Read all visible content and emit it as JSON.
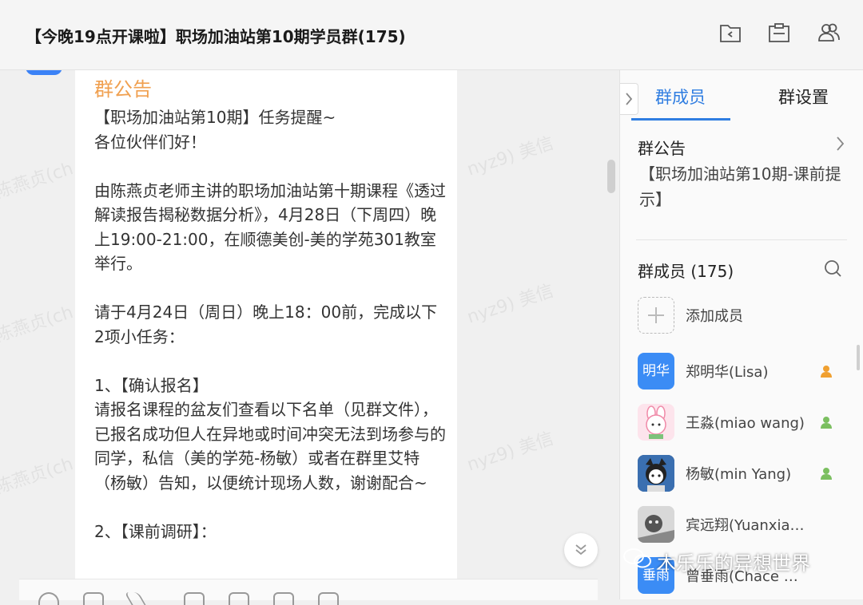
{
  "header": {
    "title": "【今晚19点开课啦】职场加油站第10期学员群(175)",
    "icons": [
      "folder-share-icon",
      "announcement-icon",
      "members-icon"
    ]
  },
  "chat": {
    "announcement_title": "群公告",
    "announcement_body": "【职场加油站第10期】任务提醒~\n各位伙伴们好！\n\n由陈燕贞老师主讲的职场加油站第十期课程《透过解读报告揭秘数据分析》，4月28日（下周四）晚上19:00-21:00，在顺德美创-美的学苑301教室举行。\n\n请于4月24日（周日）晚上18：00前，完成以下2项小任务：\n\n1、【确认报名】\n请报名课程的盆友们查看以下名单（见群文件），已报名成功但人在异地或时间冲突无法到场参与的同学，私信（美的学苑-杨敏）或者在群里艾特（杨敏）告知，以便统计现场人数，谢谢配合~\n\n2、【课前调研】：",
    "watermarks": [
      "陈燕贞(ch",
      "nyz9) 美信"
    ]
  },
  "sidebar": {
    "tabs": [
      {
        "label": "群成员",
        "active": true
      },
      {
        "label": "群设置",
        "active": false
      }
    ],
    "notice_title": "群公告",
    "notice_text": "【职场加油站第10期-课前提示】",
    "members_title": "群成员 (175)",
    "add_member_label": "添加成员",
    "members": [
      {
        "name": "郑明华(Lisa)",
        "avatar_text": "明华",
        "avatar_color": "#3b8cf5",
        "badge": "admin"
      },
      {
        "name": "王淼(miao wang)",
        "avatar_text": "",
        "avatar_color": "#f7b6c8",
        "badge": "admin"
      },
      {
        "name": "杨敏(min Yang)",
        "avatar_text": "",
        "avatar_color": "#6a6a8a",
        "badge": "admin"
      },
      {
        "name": "宾远翔(Yuanxia…",
        "avatar_text": "",
        "avatar_color": "#9a9a9a",
        "badge": ""
      },
      {
        "name": "曾垂雨(Chace …",
        "avatar_text": "垂雨",
        "avatar_color": "#3b8cf5",
        "badge": ""
      }
    ]
  },
  "overlay": {
    "wechat_watermark": "木乐乐的异想世界"
  },
  "colors": {
    "accent": "#2f7de1",
    "announcement_title": "#f0a050",
    "admin_badge": "#f0a030",
    "member_badge": "#7bbf60"
  }
}
